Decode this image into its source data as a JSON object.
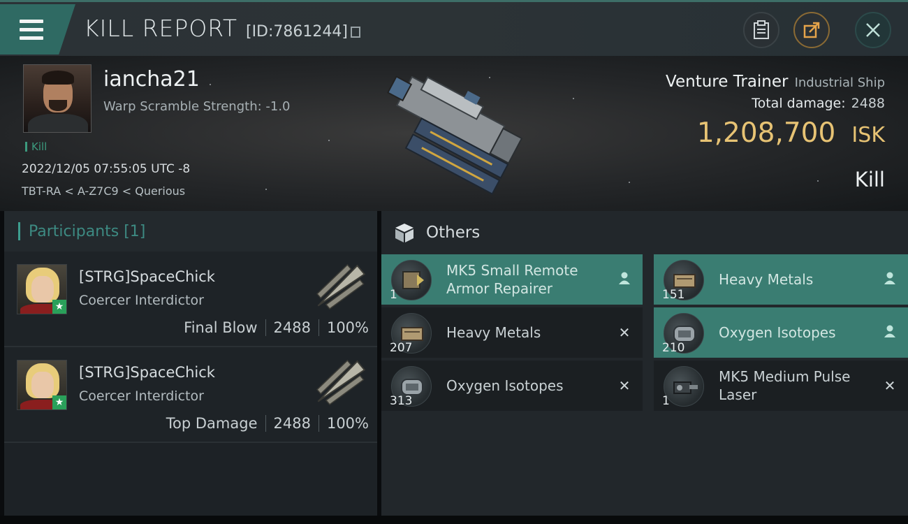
{
  "header": {
    "title": "KILL REPORT",
    "report_id": "[ID:7861244]",
    "icons": {
      "menu": "hamburger-menu-icon",
      "clipboard": "clipboard-icon",
      "share": "share-external-icon",
      "close": "close-icon"
    }
  },
  "victim": {
    "name": "iancha21",
    "warp_scramble": "Warp Scramble Strength: -1.0",
    "tag": "Kill",
    "timestamp": "2022/12/05 07:55:05 UTC -8",
    "location": "TBT-RA < A-Z7C9 < Querious",
    "ship_name": "Venture Trainer",
    "ship_class": "Industrial Ship",
    "total_damage_label": "Total damage:",
    "total_damage_value": "2488",
    "isk_value": "1,208,700",
    "isk_unit": "ISK",
    "result": "Kill"
  },
  "participants": {
    "title": "Participants [1]",
    "list": [
      {
        "name": "[STRG]SpaceChick",
        "ship": "Coercer Interdictor",
        "role": "Final Blow",
        "damage": "2488",
        "percent": "100%"
      },
      {
        "name": "[STRG]SpaceChick",
        "ship": "Coercer Interdictor",
        "role": "Top Damage",
        "damage": "2488",
        "percent": "100%"
      }
    ]
  },
  "others": {
    "title": "Others",
    "items": [
      {
        "qty": "1",
        "name": "MK5 Small Remote Armor Repairer",
        "action": "person-icon",
        "highlight": true
      },
      {
        "qty": "151",
        "name": "Heavy Metals",
        "action": "person-icon",
        "highlight": true
      },
      {
        "qty": "207",
        "name": "Heavy Metals",
        "action": "destroyed-x-icon",
        "highlight": false
      },
      {
        "qty": "210",
        "name": "Oxygen Isotopes",
        "action": "person-icon",
        "highlight": true
      },
      {
        "qty": "313",
        "name": "Oxygen Isotopes",
        "action": "destroyed-x-icon",
        "highlight": false
      },
      {
        "qty": "1",
        "name": "MK5 Medium Pulse Laser",
        "action": "destroyed-x-icon",
        "highlight": false
      }
    ]
  },
  "colors": {
    "accent_teal": "#3a7d72",
    "isk_gold": "#e7c374",
    "kill_green": "#3c9a7e"
  }
}
